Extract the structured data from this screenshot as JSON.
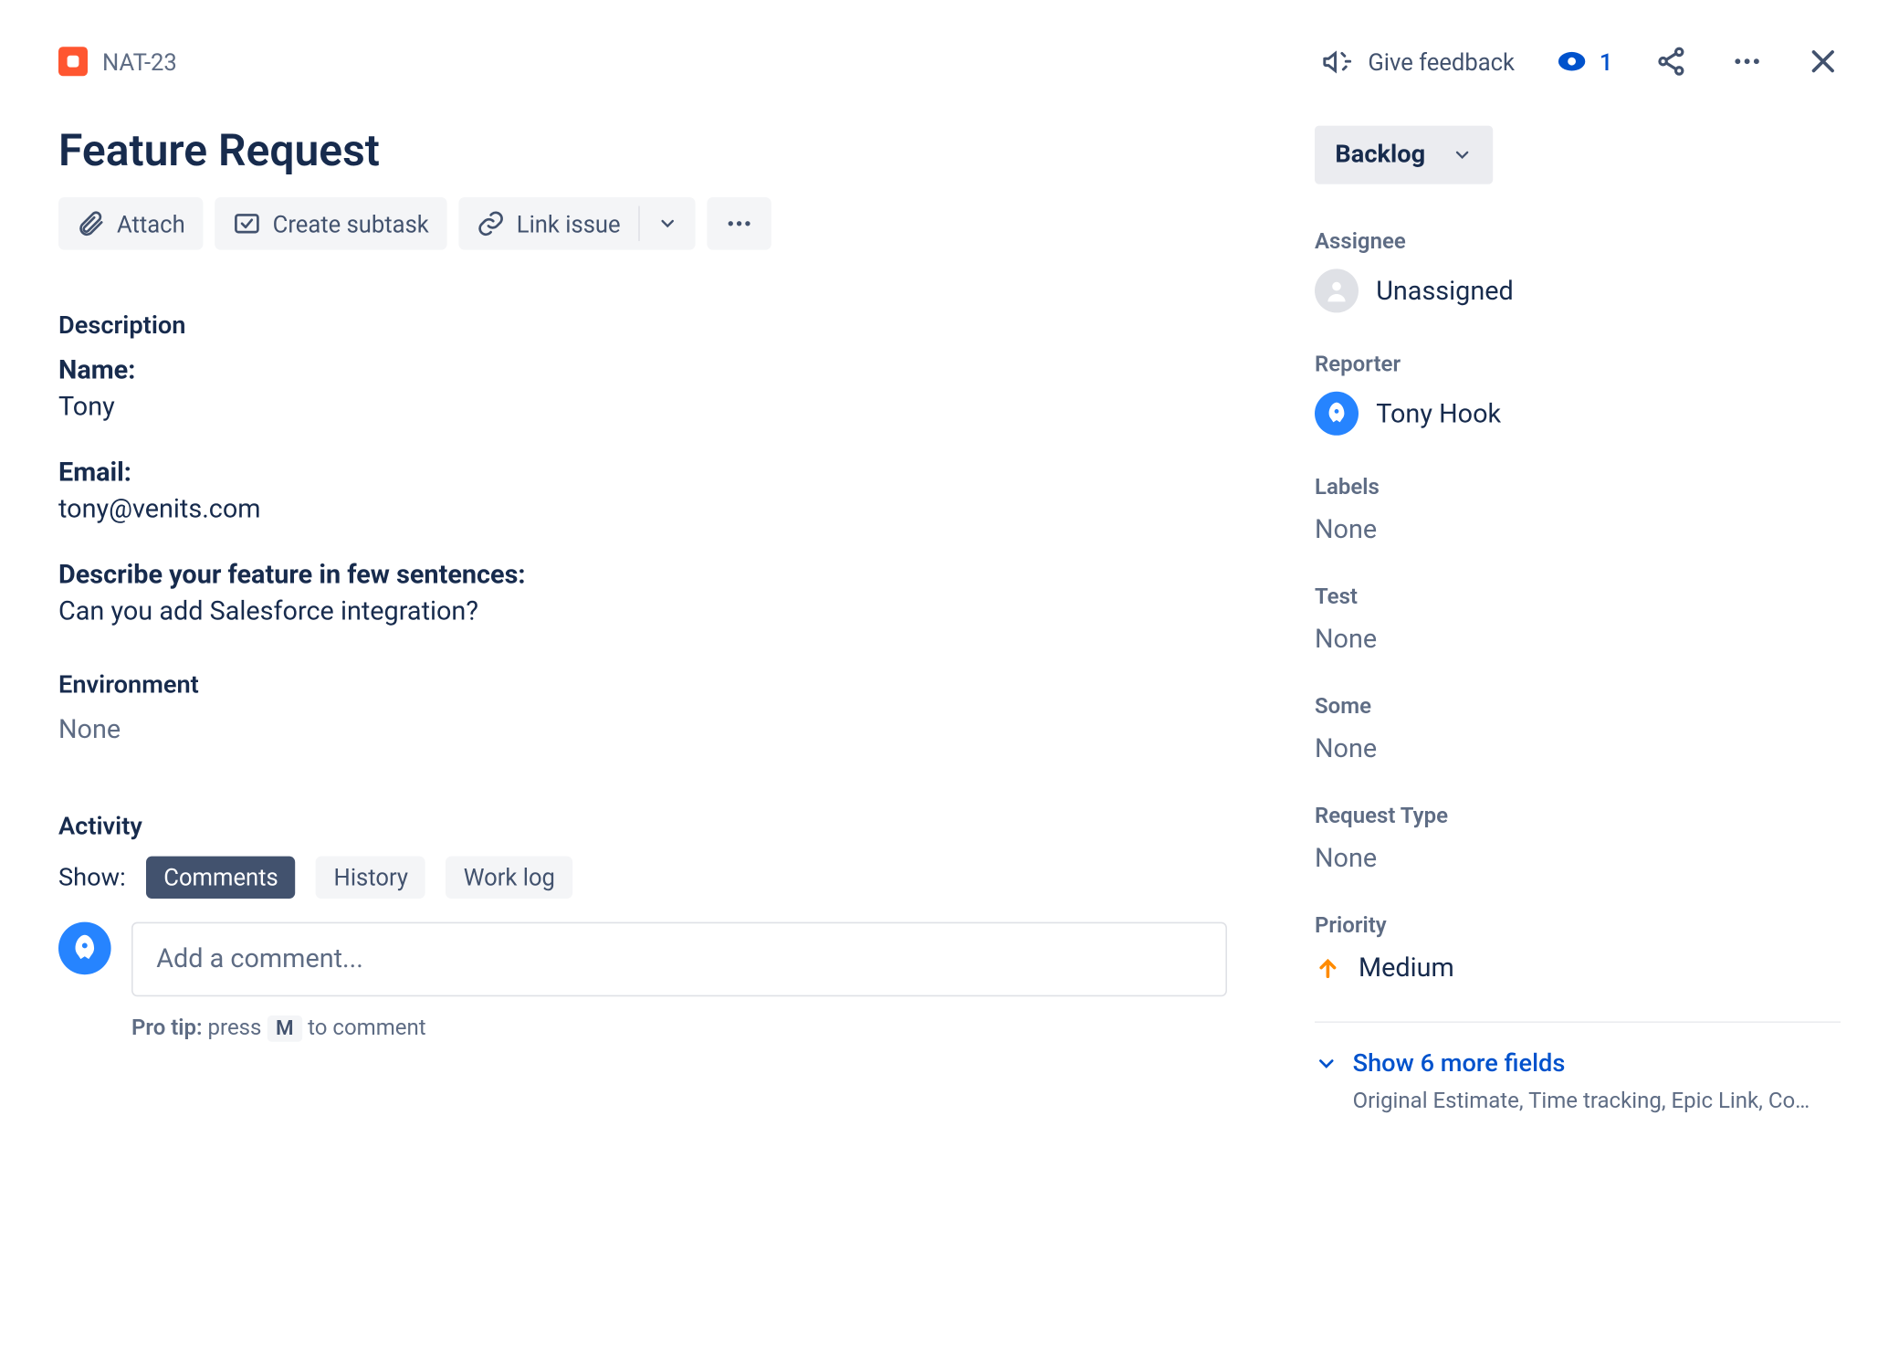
{
  "header": {
    "issue_key": "NAT-23",
    "feedback": "Give feedback",
    "watch_count": "1"
  },
  "issue": {
    "title": "Feature Request"
  },
  "toolbar": {
    "attach": "Attach",
    "create_subtask": "Create subtask",
    "link_issue": "Link issue"
  },
  "description": {
    "heading": "Description",
    "name_label": "Name:",
    "name_value": "Tony",
    "email_label": "Email:",
    "email_value": "tony@venits.com",
    "feature_label": "Describe your feature in few sentences:",
    "feature_value": "Can you add Salesforce integration?"
  },
  "environment": {
    "heading": "Environment",
    "value": "None"
  },
  "activity": {
    "heading": "Activity",
    "show_label": "Show:",
    "tabs": {
      "comments": "Comments",
      "history": "History",
      "worklog": "Work log"
    },
    "comment_placeholder": "Add a comment...",
    "protip_prefix": "Pro tip:",
    "protip_press": " press ",
    "protip_key": "M",
    "protip_suffix": " to comment"
  },
  "side": {
    "status": "Backlog",
    "assignee_label": "Assignee",
    "assignee_value": "Unassigned",
    "reporter_label": "Reporter",
    "reporter_value": "Tony Hook",
    "labels_label": "Labels",
    "labels_value": "None",
    "test_label": "Test",
    "test_value": "None",
    "some_label": "Some",
    "some_value": "None",
    "request_type_label": "Request Type",
    "request_type_value": "None",
    "priority_label": "Priority",
    "priority_value": "Medium",
    "more_link": "Show 6 more fields",
    "more_detail": "Original Estimate, Time tracking, Epic Link, Co…"
  }
}
